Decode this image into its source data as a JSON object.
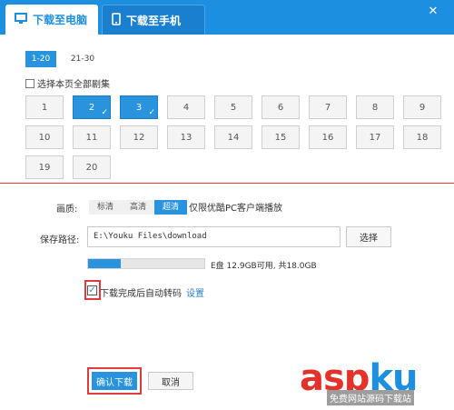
{
  "tabs": {
    "pc": {
      "label": "下载至电脑",
      "icon": "monitor-icon"
    },
    "phone": {
      "label": "下载至手机",
      "icon": "phone-icon"
    }
  },
  "window_controls": {
    "close_icon": "close-icon"
  },
  "ranges": [
    "1-20",
    "21-30"
  ],
  "select_all_label": "选择本页全部剧集",
  "episodes": [
    "1",
    "2",
    "3",
    "4",
    "5",
    "6",
    "7",
    "8",
    "9",
    "10",
    "11",
    "12",
    "13",
    "14",
    "15",
    "16",
    "17",
    "18",
    "19",
    "20"
  ],
  "selected_episodes": [
    "2",
    "3"
  ],
  "quality": {
    "label": "画质:",
    "options": [
      "标清",
      "高清",
      "超清"
    ],
    "selected": "超清",
    "note": "仅限优酷PC客户端播放"
  },
  "save_path": {
    "label": "保存路径:",
    "value": "E:\\Youku Files\\download",
    "browse_label": "选择"
  },
  "disk": {
    "text": "E盘 12.9GB可用, 共18.0GB",
    "used_fraction": 0.28
  },
  "auto_transcode": {
    "label": "下载完成后自动转码",
    "checked": true,
    "settings_label": "设置"
  },
  "buttons": {
    "confirm": "确认下载",
    "cancel": "取消"
  },
  "watermark": {
    "main": "aspku",
    "sub": "免费网站源码下载站"
  },
  "colors": {
    "accent": "#2a93de",
    "highlight": "#e23a3a"
  }
}
